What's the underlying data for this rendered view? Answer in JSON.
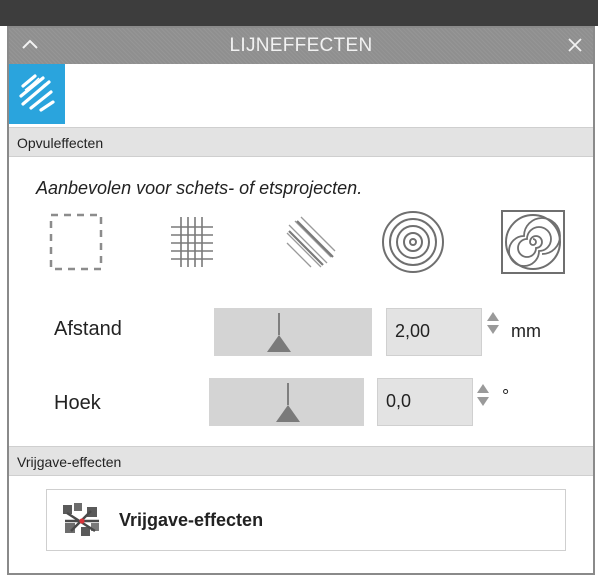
{
  "window": {
    "title": "LIJNEFFECTEN"
  },
  "sections": {
    "fill": {
      "header": "Opvuleffecten",
      "hint": "Aanbevolen voor schets- of etsprojecten."
    },
    "release": {
      "header": "Vrijgave-effecten",
      "button_label": "Vrijgave-effecten"
    }
  },
  "patterns": [
    {
      "name": "none-pattern-icon"
    },
    {
      "name": "grid-pattern-icon"
    },
    {
      "name": "diagonal-lines-pattern-icon"
    },
    {
      "name": "concentric-circles-pattern-icon"
    },
    {
      "name": "spiral-pattern-icon"
    }
  ],
  "controls": {
    "distance": {
      "label": "Afstand",
      "value": "2,00",
      "unit": "mm"
    },
    "angle": {
      "label": "Hoek",
      "value": "0,0",
      "unit": "°"
    }
  },
  "colors": {
    "accent": "#2aa4dd",
    "titlebar": "#8f8f8f",
    "section": "#e3e3e3"
  }
}
